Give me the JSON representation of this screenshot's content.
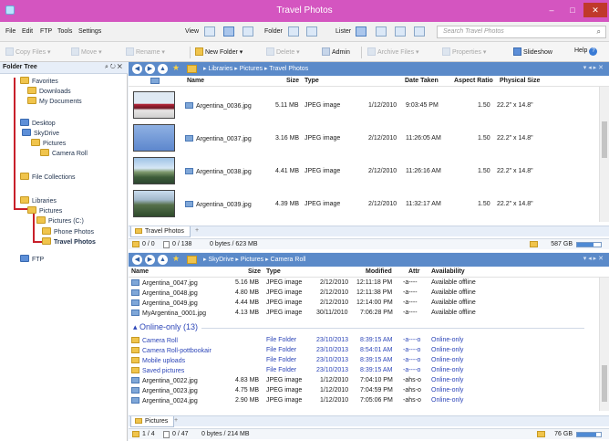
{
  "window": {
    "title": "Travel Photos"
  },
  "menu": [
    "File",
    "Edit",
    "FTP",
    "Tools",
    "Settings"
  ],
  "view": {
    "view_label": "View",
    "folder_label": "Folder",
    "lister_label": "Lister",
    "search_placeholder": "Search Travel Photos"
  },
  "toolbar": {
    "copy": "Copy Files",
    "move": "Move",
    "rename": "Rename",
    "new_folder": "New Folder",
    "delete": "Delete",
    "admin": "Admin",
    "archive": "Archive Files",
    "properties": "Properties",
    "slideshow": "Slideshow",
    "help": "Help"
  },
  "tree": {
    "header": "Folder Tree",
    "header_controls": "⌕ ↻ ✕",
    "items": [
      "Favorites",
      "Downloads",
      "My Documents",
      "Desktop",
      "SkyDrive",
      "Pictures",
      "Camera Roll",
      "File Collections",
      "Libraries",
      "Pictures",
      "Pictures (C:)",
      "Phone Photos",
      "Travel Photos",
      "FTP"
    ]
  },
  "pane1": {
    "breadcrumb": "▸ Libraries ▸ Pictures ▸ Travel Photos",
    "columns": [
      "Name",
      "Size",
      "Type",
      "Date Taken",
      "Aspect Ratio",
      "Physical Size"
    ],
    "rows": [
      {
        "name": "Argentina_0036.jpg",
        "size": "5.11 MB",
        "type": "JPEG image",
        "date": "1/12/2010",
        "time": "9:03:45 PM",
        "aspect": "1.50",
        "physical": "22.2\" x 14.8\""
      },
      {
        "name": "Argentina_0037.jpg",
        "size": "3.16 MB",
        "type": "JPEG image",
        "date": "2/12/2010",
        "time": "11:26:05 AM",
        "aspect": "1.50",
        "physical": "22.2\" x 14.8\""
      },
      {
        "name": "Argentina_0038.jpg",
        "size": "4.41 MB",
        "type": "JPEG image",
        "date": "2/12/2010",
        "time": "11:26:16 AM",
        "aspect": "1.50",
        "physical": "22.2\" x 14.8\""
      },
      {
        "name": "Argentina_0039.jpg",
        "size": "4.39 MB",
        "type": "JPEG image",
        "date": "2/12/2010",
        "time": "11:32:17 AM",
        "aspect": "1.50",
        "physical": "22.2\" x 14.8\""
      }
    ],
    "tab": "Travel Photos",
    "status": {
      "selected": "0 / 0",
      "files": "0 / 138",
      "bytes": "0 bytes / 623 MB",
      "free": "587 GB"
    }
  },
  "pane2": {
    "breadcrumb": "▸ SkyDrive ▸ Pictures ▸ Camera Roll",
    "columns": [
      "Name",
      "Size",
      "Type",
      "Modified",
      "Attr",
      "Availability"
    ],
    "rows": [
      {
        "name": "Argentina_0047.jpg",
        "size": "5.16 MB",
        "type": "JPEG image",
        "date": "2/12/2010",
        "time": "12:11:18 PM",
        "attr": "-a----",
        "avail": "Available offline"
      },
      {
        "name": "Argentina_0048.jpg",
        "size": "4.80 MB",
        "type": "JPEG image",
        "date": "2/12/2010",
        "time": "12:11:38 PM",
        "attr": "-a----",
        "avail": "Available offline"
      },
      {
        "name": "Argentina_0049.jpg",
        "size": "4.44 MB",
        "type": "JPEG image",
        "date": "2/12/2010",
        "time": "12:14:00 PM",
        "attr": "-a----",
        "avail": "Available offline"
      },
      {
        "name": "MyArgentina_0001.jpg",
        "size": "4.13 MB",
        "type": "JPEG image",
        "date": "30/11/2010",
        "time": "7:06:28 PM",
        "attr": "-a----",
        "avail": "Available offline"
      }
    ],
    "group": "▴ Online-only (13)",
    "online_rows": [
      {
        "name": "Camera Roll",
        "size": "",
        "type": "File Folder",
        "date": "23/10/2013",
        "time": "8:39:15 AM",
        "attr": "-a----o",
        "avail": "Online-only",
        "folder": true
      },
      {
        "name": "Camera Roll-pottbookair",
        "size": "",
        "type": "File Folder",
        "date": "23/10/2013",
        "time": "8:54:01 AM",
        "attr": "-a----o",
        "avail": "Online-only",
        "folder": true
      },
      {
        "name": "Mobile uploads",
        "size": "",
        "type": "File Folder",
        "date": "23/10/2013",
        "time": "8:39:15 AM",
        "attr": "-a----o",
        "avail": "Online-only",
        "folder": true
      },
      {
        "name": "Saved pictures",
        "size": "",
        "type": "File Folder",
        "date": "23/10/2013",
        "time": "8:39:15 AM",
        "attr": "-a----o",
        "avail": "Online-only",
        "folder": true
      },
      {
        "name": "Argentina_0022.jpg",
        "size": "4.83 MB",
        "type": "JPEG image",
        "date": "1/12/2010",
        "time": "7:04:10 PM",
        "attr": "-ahs-o",
        "avail": "Online-only",
        "folder": false
      },
      {
        "name": "Argentina_0023.jpg",
        "size": "4.75 MB",
        "type": "JPEG image",
        "date": "1/12/2010",
        "time": "7:04:59 PM",
        "attr": "-ahs-o",
        "avail": "Online-only",
        "folder": false
      },
      {
        "name": "Argentina_0024.jpg",
        "size": "2.90 MB",
        "type": "JPEG image",
        "date": "1/12/2010",
        "time": "7:05:06 PM",
        "attr": "-ahs-o",
        "avail": "Online-only",
        "folder": false
      }
    ],
    "tab": "Pictures",
    "status": {
      "selected": "1 / 4",
      "files": "0 / 47",
      "bytes": "0 bytes / 214 MB",
      "free": "76 GB"
    }
  },
  "icons": {
    "back": "◀",
    "forward": "▶",
    "up": "▲",
    "star": "★",
    "minimize": "–",
    "maximize": "□",
    "close": "✕",
    "search": "⌕",
    "pane_controls": "▾ ◂ ▸ ✕",
    "tab_add": "+"
  },
  "colors": {
    "title_bar": "#d455c0",
    "address_bar": "#5b8ac9",
    "tree_line": "#c8202a",
    "online_text": "#2d46b8"
  }
}
